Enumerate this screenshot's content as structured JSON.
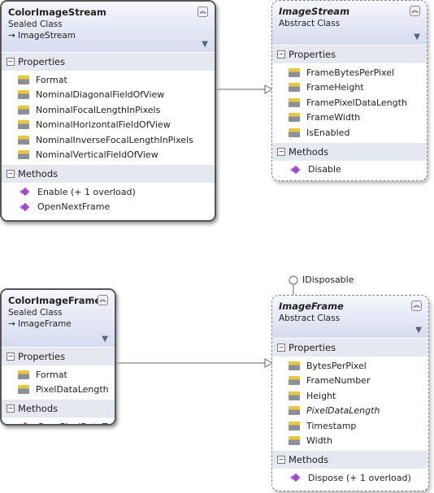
{
  "classes": [
    {
      "id": "colorimagestream",
      "name": "ColorImageStream",
      "kind": "Sealed Class",
      "base": "ImageStream",
      "style": "solid",
      "properties": [
        "Format",
        "NominalDiagonalFieldOfView",
        "NominalFocalLengthInPixels",
        "NominalHorizontalFieldOfView",
        "NominalInverseFocalLengthInPixels",
        "NominalVerticalFieldOfView"
      ],
      "methods": [
        "Enable (+ 1 overload)",
        "OpenNextFrame"
      ]
    },
    {
      "id": "imagestream",
      "name": "ImageStream",
      "kind": "Abstract Class",
      "style": "dashed",
      "properties": [
        "FrameBytesPerPixel",
        "FrameHeight",
        "FramePixelDataLength",
        "FrameWidth",
        "IsEnabled"
      ],
      "methods": [
        "Disable"
      ]
    },
    {
      "id": "colorimageframe",
      "name": "ColorImageFrame",
      "kind": "Sealed Class",
      "base": "ImageFrame",
      "style": "solid",
      "properties": [
        "Format",
        "PixelDataLength"
      ],
      "methods": [
        "CopyPixelDataTo"
      ]
    },
    {
      "id": "imageframe",
      "name": "ImageFrame",
      "kind": "Abstract Class",
      "style": "dashed",
      "interface": "IDisposable",
      "properties": [
        "BytesPerPixel",
        "FrameNumber",
        "Height",
        "PixelDataLength",
        "Timestamp",
        "Width"
      ],
      "italic_properties": [
        "PixelDataLength"
      ],
      "methods": [
        "Dispose (+ 1 overload)"
      ]
    }
  ],
  "labels": {
    "properties": "Properties",
    "methods": "Methods",
    "base_arrow": "→"
  },
  "icons": {
    "collapse": "double-chevron-up-icon",
    "filter": "filter-icon",
    "property": "property-icon",
    "method": "method-icon"
  }
}
